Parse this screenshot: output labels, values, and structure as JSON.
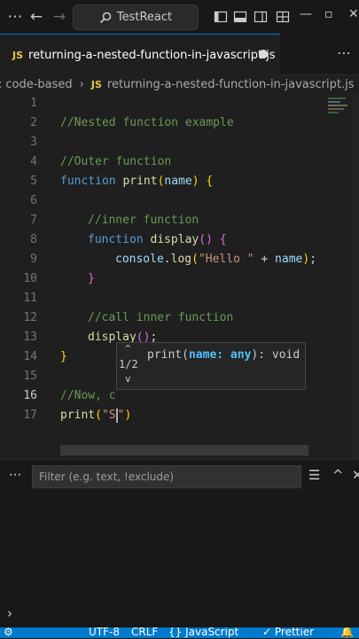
{
  "titlebar": {
    "search_label": "TestReact",
    "nav_back_icon": "arrow-left-icon",
    "nav_forward_icon": "arrow-right-icon"
  },
  "tab": {
    "label": "returning-a-nested-function-in-javascript.js",
    "badge": "JS"
  },
  "breadcrumb": {
    "folder": "code-based",
    "badge": "JS",
    "file": "returning-a-nested-function-in-javascript.js"
  },
  "editor": {
    "line_numbers": [
      "1",
      "2",
      "3",
      "4",
      "5",
      "6",
      "7",
      "8",
      "9",
      "10",
      "11",
      "12",
      "13",
      "14",
      "15",
      "16",
      "17"
    ],
    "comment_1": "//Nested function example",
    "comment_3": "//Outer function",
    "kw_function": "function",
    "fn_print": "print",
    "param_name": "name",
    "comment_6": "//inner function",
    "fn_display": "display",
    "console": "console",
    "log": "log",
    "str_hello": "\"Hello \"",
    "comment_11": "//call inner function",
    "comment_15": "//Now, c",
    "str_typed": "\"S",
    "str_close": "\""
  },
  "hint": {
    "count": "1/2",
    "fn": "print(",
    "param": "name: any",
    "ret": "): void"
  },
  "panel": {
    "filter_placeholder": "Filter (e.g. text, !exclude)",
    "ellipsis": "···"
  },
  "statusbar": {
    "encoding": "UTF-8",
    "eol": "CRLF",
    "language": "JavaScript",
    "formatter": "Prettier"
  },
  "colors": {
    "accent": "#007acc",
    "comment": "#6a9955",
    "keyword": "#569cd6",
    "function": "#dcdcaa"
  }
}
